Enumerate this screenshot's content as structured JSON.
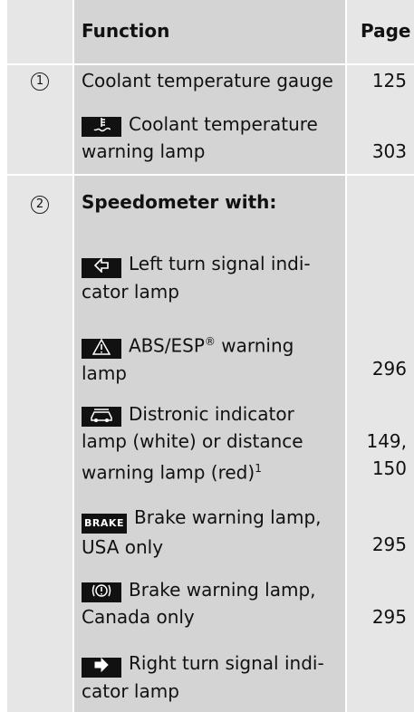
{
  "header": {
    "function": "Function",
    "page": "Page"
  },
  "rows": [
    {
      "number": "1",
      "items": [
        {
          "text": "Coolant temperature gauge",
          "page": "125"
        },
        {
          "icon": "coolant-icon",
          "text_line1": "Coolant temperature",
          "text_line2": "warning lamp",
          "page": "303"
        }
      ]
    },
    {
      "number": "2",
      "title": "Speedometer with:",
      "items": [
        {
          "icon": "left-turn-icon",
          "text_line1": "Left turn signal indi-",
          "text_line2": "cator lamp",
          "page": ""
        },
        {
          "icon": "warning-triangle-icon",
          "text_line1": "ABS/ESP",
          "sup": "®",
          "text_line1_tail": " warning",
          "text_line2": "lamp",
          "page": "296"
        },
        {
          "icon": "distronic-car-icon",
          "text_line1": "Distronic indicator",
          "text_line2": "lamp (white) or distance",
          "text_line3": "warning lamp (red)",
          "sup": "1",
          "page_line1": "149,",
          "page_line2": "150"
        },
        {
          "icon": "brake-text-icon",
          "icon_text": "BRAKE",
          "text_line1": "Brake warning lamp,",
          "text_line2": "USA only",
          "page": "295"
        },
        {
          "icon": "brake-circle-icon",
          "text_line1": "Brake warning lamp,",
          "text_line2": "Canada only",
          "page": "295"
        },
        {
          "icon": "right-turn-icon",
          "text_line1": "Right turn signal indi-",
          "text_line2": "cator lamp",
          "page": ""
        }
      ]
    }
  ]
}
